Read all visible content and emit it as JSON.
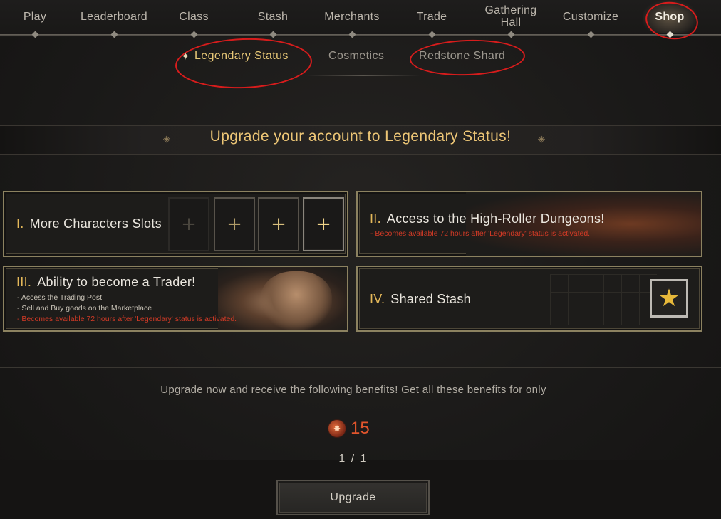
{
  "nav": {
    "items": [
      {
        "label": "Play"
      },
      {
        "label": "Leaderboard"
      },
      {
        "label": "Class"
      },
      {
        "label": "Stash"
      },
      {
        "label": "Merchants"
      },
      {
        "label": "Trade"
      },
      {
        "label": "Gathering Hall"
      },
      {
        "label": "Customize"
      },
      {
        "label": "Shop"
      }
    ],
    "active": "Shop"
  },
  "subtabs": {
    "items": [
      {
        "label": "Legendary Status"
      },
      {
        "label": "Cosmetics"
      },
      {
        "label": "Redstone Shard"
      }
    ],
    "active": "Legendary Status"
  },
  "banner": {
    "title": "Upgrade your account to Legendary Status!"
  },
  "cards": {
    "c1": {
      "num": "I.",
      "title": "More Characters Slots"
    },
    "c2": {
      "num": "II.",
      "title": "Access to the High-Roller Dungeons!",
      "note": "- Becomes available 72 hours after 'Legendary' status is activated."
    },
    "c3": {
      "num": "III.",
      "title": "Ability to become a Trader!",
      "notes": [
        "- Access the Trading Post",
        "- Sell and Buy goods on the Marketplace"
      ],
      "note_red": "- Becomes available 72 hours after 'Legendary' status is activated."
    },
    "c4": {
      "num": "IV.",
      "title": "Shared Stash"
    }
  },
  "offer": {
    "benefits_text": "Upgrade now and receive the following benefits! Get all these benefits for only",
    "price": "15",
    "pager": "1 / 1",
    "upgrade_label": "Upgrade"
  },
  "icons": {
    "subtab_active": "sparkle-icon",
    "slot": "plus-icon",
    "stash": "star-icon",
    "currency": "redstone-shard-icon"
  },
  "colors": {
    "accent_gold": "#edc676",
    "price_red": "#e2552c",
    "annotation_red": "#d81c1c"
  }
}
